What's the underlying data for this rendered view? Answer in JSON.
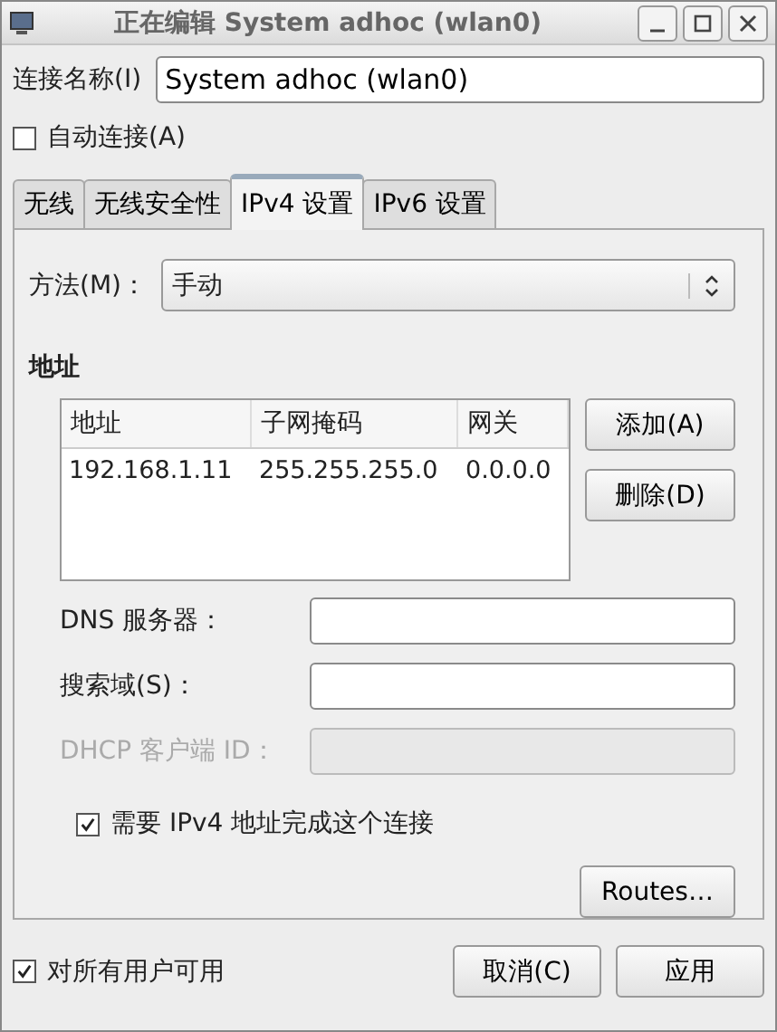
{
  "window": {
    "title": "正在编辑 System adhoc (wlan0)"
  },
  "connection_name": {
    "label": "连接名称(I)",
    "value": "System adhoc (wlan0)"
  },
  "auto_connect": {
    "label": "自动连接(A)",
    "checked": false
  },
  "tabs": [
    {
      "label": "无线",
      "selected": false
    },
    {
      "label": "无线安全性",
      "selected": false
    },
    {
      "label": "IPv4 设置",
      "selected": true
    },
    {
      "label": "IPv6 设置",
      "selected": false
    }
  ],
  "method": {
    "label": "方法(M)：",
    "value": "手动"
  },
  "addresses": {
    "heading": "地址",
    "columns": [
      "地址",
      "子网掩码",
      "网关"
    ],
    "rows": [
      [
        "192.168.1.11",
        "255.255.255.0",
        "0.0.0.0"
      ]
    ],
    "buttons": [
      "添加(A)",
      "删除(D)"
    ]
  },
  "fields": [
    {
      "label": "DNS 服务器：",
      "disabled": false
    },
    {
      "label": "搜索域(S)：",
      "disabled": false
    },
    {
      "label": "DHCP 客户端 ID：",
      "disabled": true
    }
  ],
  "require_ipv4": {
    "label": "需要 IPv4 地址完成这个连接",
    "checked": true
  },
  "routes_button": "Routes…",
  "all_users": {
    "label": "对所有用户可用",
    "checked": true
  },
  "footer_buttons": [
    "取消(C)",
    "应用"
  ]
}
